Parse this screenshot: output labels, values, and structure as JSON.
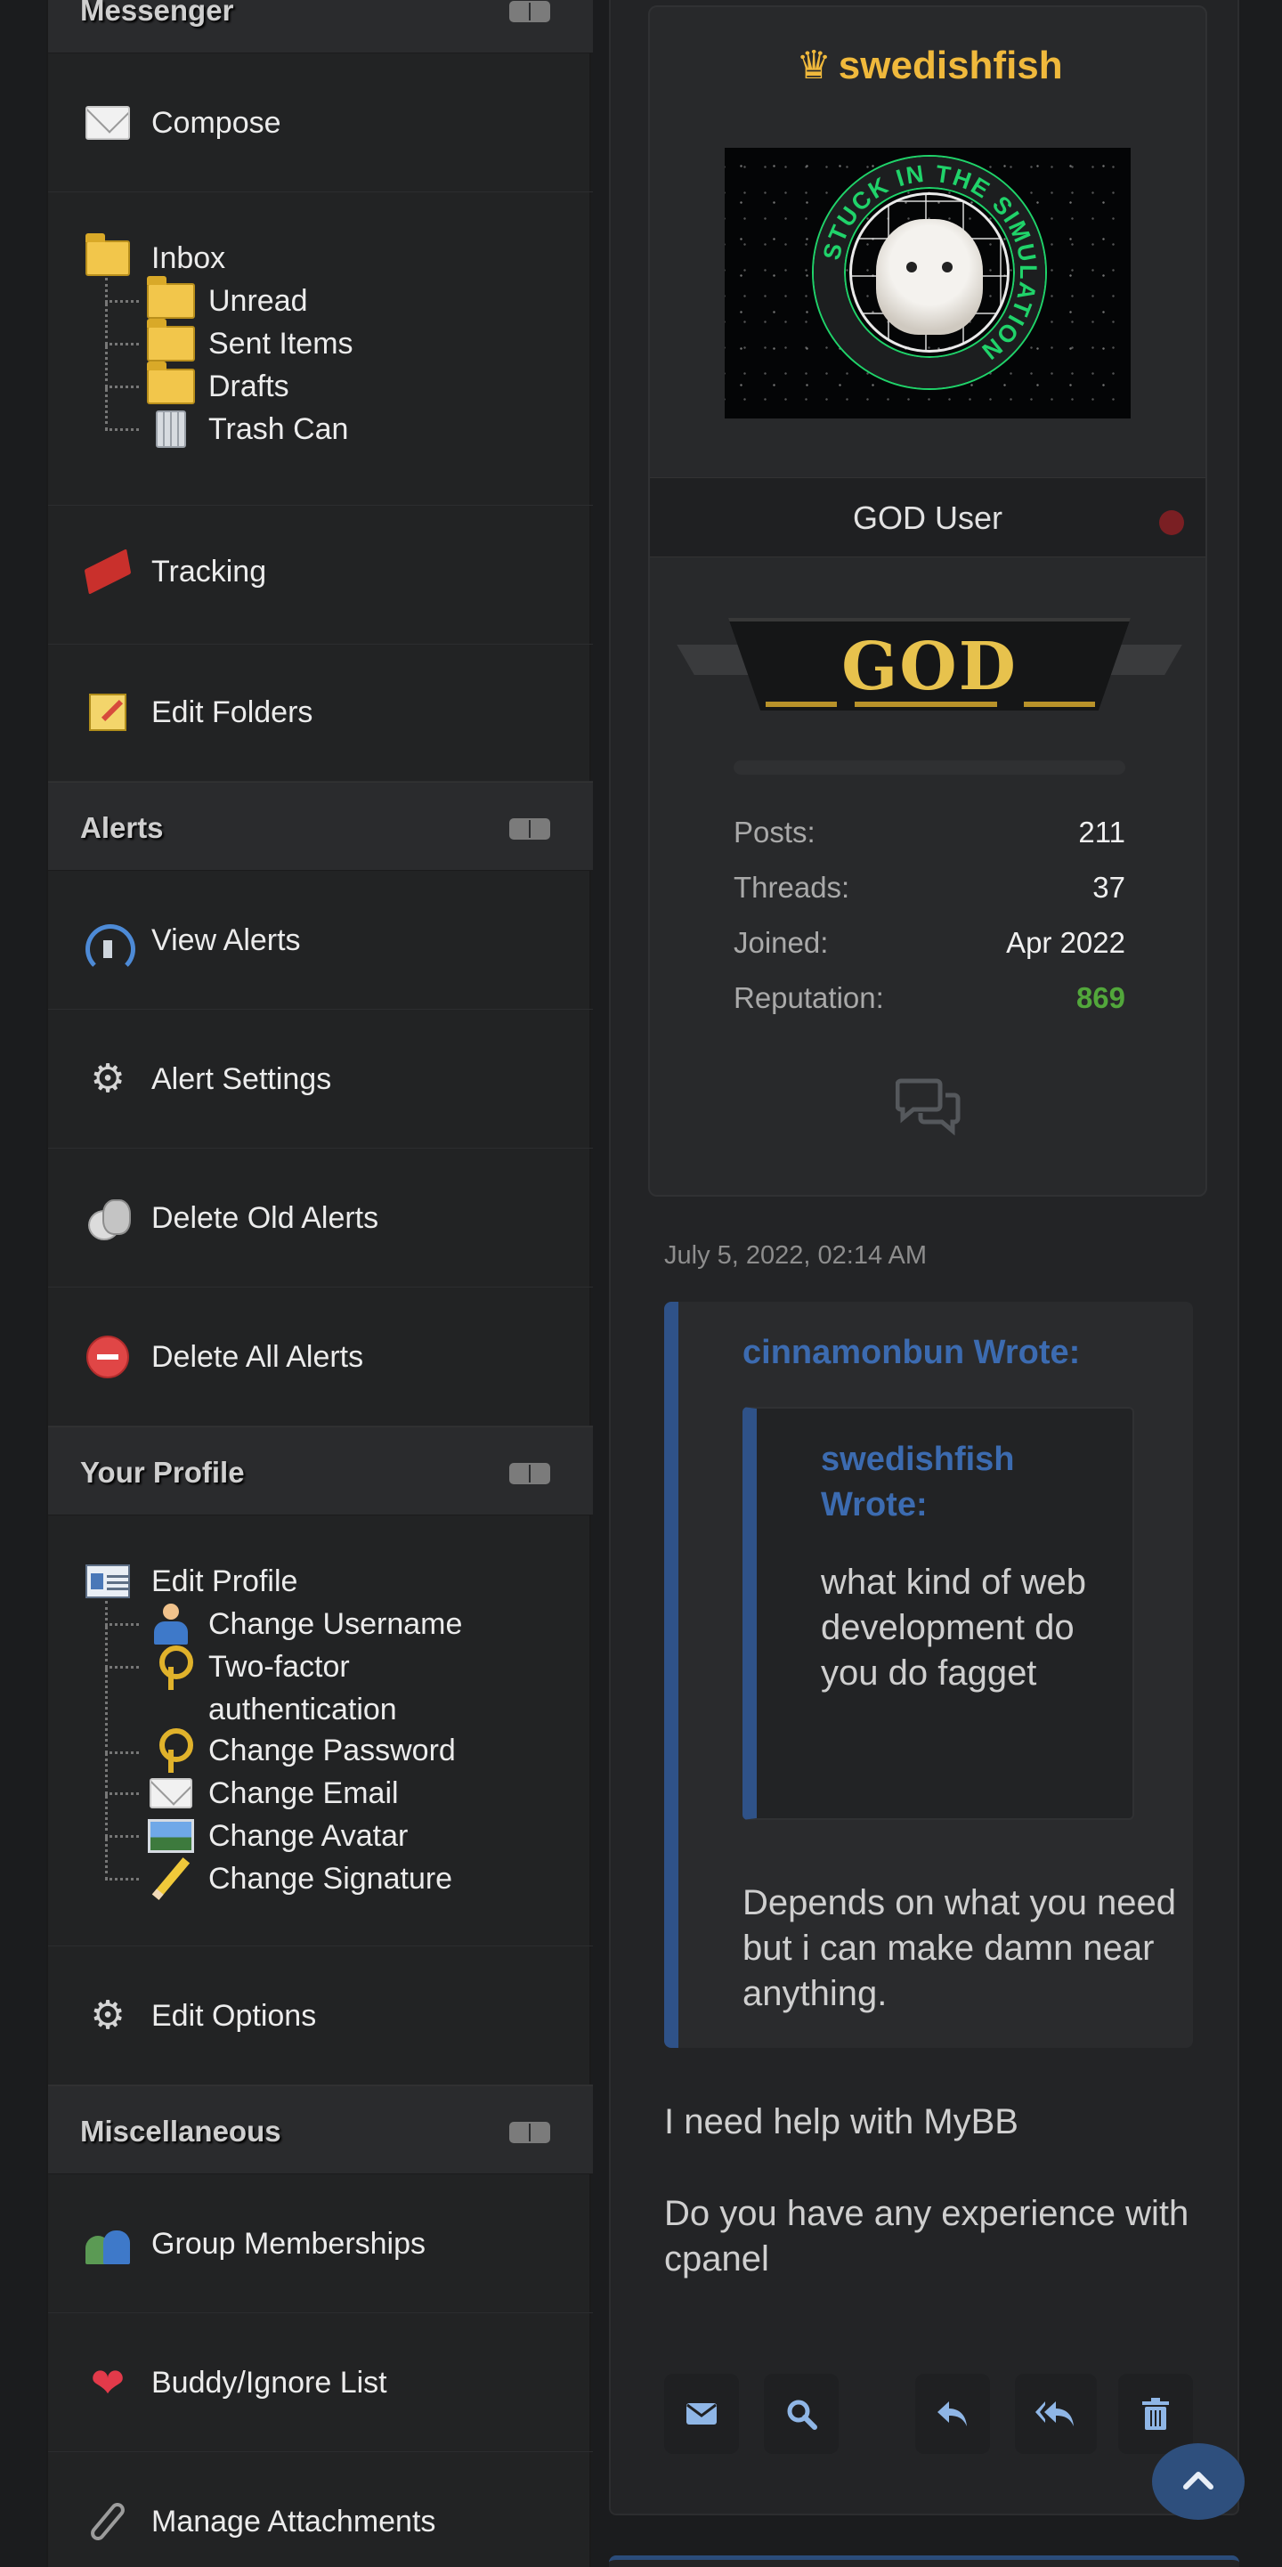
{
  "sidebar": {
    "sections": {
      "messenger": {
        "title": "Messenger"
      },
      "alerts": {
        "title": "Alerts"
      },
      "profile": {
        "title": "Your Profile"
      },
      "misc": {
        "title": "Miscellaneous"
      }
    },
    "messenger": {
      "compose": "Compose",
      "inbox": "Inbox",
      "unread": "Unread",
      "sent": "Sent Items",
      "drafts": "Drafts",
      "trash": "Trash Can",
      "tracking": "Tracking",
      "edit_folders": "Edit Folders"
    },
    "alerts": {
      "view": "View Alerts",
      "settings": "Alert Settings",
      "delete_old": "Delete Old Alerts",
      "delete_all": "Delete All Alerts"
    },
    "profile": {
      "edit_profile": "Edit Profile",
      "change_username": "Change Username",
      "two_factor": "Two-factor authentication",
      "change_password": "Change Password",
      "change_email": "Change Email",
      "change_avatar": "Change Avatar",
      "change_signature": "Change Signature",
      "edit_options": "Edit Options"
    },
    "misc": {
      "group_memberships": "Group Memberships",
      "buddy_list": "Buddy/Ignore List",
      "manage_attachments": "Manage Attachments"
    }
  },
  "post": {
    "author": {
      "name": "swedishfish",
      "avatar_text": "STUCK IN THE SIMULATION",
      "group": "GOD User",
      "banner": "GOD",
      "stats": [
        {
          "label": "Posts:",
          "value": "211"
        },
        {
          "label": "Threads:",
          "value": "37"
        },
        {
          "label": "Joined:",
          "value": "Apr 2022"
        },
        {
          "label": "Reputation:",
          "value": "869"
        }
      ]
    },
    "date": "July 5, 2022, 02:14 AM",
    "quote": {
      "author": "cinnamonbun Wrote:",
      "nested_author": "swedishfish Wrote:",
      "nested_text": "what kind of web development do you do fagget",
      "text": "Depends on what you need but i can make damn near anything."
    },
    "body": [
      "I need help with MyBB",
      "Do you have any experience with cpanel"
    ]
  },
  "colors": {
    "accent": "#2f5288",
    "username": "#f0b93c",
    "reputation": "#52a73b"
  },
  "icons": {
    "compose": "envelope-icon",
    "folders": "folder-icon",
    "trash": "trash-icon",
    "tracking": "flag-icon",
    "edit_folders": "note-icon",
    "view_alerts": "radar-icon",
    "settings": "gear-icon",
    "delete_old": "coins-icon",
    "delete_all": "stop-icon",
    "buttons": [
      "email-icon",
      "search-icon",
      "reply-icon",
      "reply-all-icon",
      "trash-icon",
      "chevron-up-icon"
    ]
  }
}
